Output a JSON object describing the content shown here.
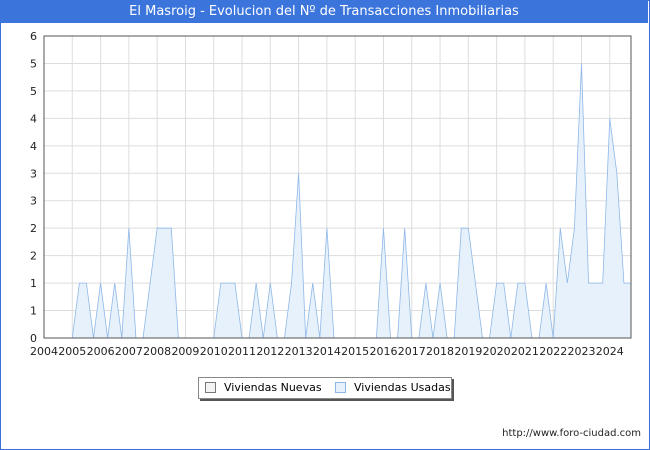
{
  "title": "El Masroig - Evolucion del Nº de Transacciones Inmobiliarias",
  "source_url": "http://www.foro-ciudad.com",
  "colors": {
    "title_bg": "#3b75dc",
    "nuevas": "#f4f4f4",
    "usadas_fill": "#e6f1fb",
    "usadas_line": "#8fb8e8",
    "grid": "#dddddd"
  },
  "chart_data": {
    "type": "area",
    "x_tick_labels": [
      "2004",
      "2005",
      "2006",
      "2007",
      "2008",
      "2009",
      "2010",
      "2011",
      "2012",
      "2013",
      "2014",
      "2015",
      "2016",
      "2017",
      "2018",
      "2019",
      "2020",
      "2021",
      "2022",
      "2023",
      "2024"
    ],
    "y_tick_labels": [
      "0",
      "1",
      "1",
      "2",
      "2",
      "3",
      "3",
      "4",
      "4",
      "5",
      "5",
      "6"
    ],
    "ylim": [
      0,
      5.5
    ],
    "xlim": [
      2004,
      2024.75
    ],
    "legend": {
      "position": "bottom-center",
      "entries": [
        "Viviendas Nuevas",
        "Viviendas Usadas"
      ]
    },
    "series": [
      {
        "name": "Viviendas Usadas",
        "x": [
          2005.0,
          2005.25,
          2005.5,
          2005.75,
          2006.0,
          2006.25,
          2006.5,
          2006.75,
          2007.0,
          2007.25,
          2007.5,
          2007.75,
          2008.0,
          2008.25,
          2008.5,
          2008.75,
          2009.0,
          2009.25,
          2009.5,
          2009.75,
          2010.0,
          2010.25,
          2010.5,
          2010.75,
          2011.0,
          2011.25,
          2011.5,
          2011.75,
          2012.0,
          2012.25,
          2012.5,
          2012.75,
          2013.0,
          2013.25,
          2013.5,
          2013.75,
          2014.0,
          2014.25,
          2014.5,
          2014.75,
          2015.0,
          2015.25,
          2015.5,
          2015.75,
          2016.0,
          2016.25,
          2016.5,
          2016.75,
          2017.0,
          2017.25,
          2017.5,
          2017.75,
          2018.0,
          2018.25,
          2018.5,
          2018.75,
          2019.0,
          2019.25,
          2019.5,
          2019.75,
          2020.0,
          2020.25,
          2020.5,
          2020.75,
          2021.0,
          2021.25,
          2021.5,
          2021.75,
          2022.0,
          2022.25,
          2022.5,
          2022.75,
          2023.0,
          2023.25,
          2023.5,
          2023.75,
          2024.0,
          2024.25,
          2024.5,
          2024.75
        ],
        "values": [
          0,
          1,
          1,
          0,
          1,
          0,
          1,
          0,
          2,
          0,
          0,
          1,
          2,
          2,
          2,
          0,
          0,
          0,
          0,
          0,
          0,
          1,
          1,
          1,
          0,
          0,
          1,
          0,
          1,
          0,
          0,
          1,
          3,
          0,
          1,
          0,
          2,
          0,
          0,
          0,
          0,
          0,
          0,
          0,
          2,
          0,
          0,
          2,
          0,
          0,
          1,
          0,
          1,
          0,
          0,
          2,
          2,
          1,
          0,
          0,
          1,
          1,
          0,
          1,
          1,
          0,
          0,
          1,
          0,
          2,
          1,
          2,
          5,
          1,
          1,
          1,
          4,
          3,
          1,
          1
        ]
      },
      {
        "name": "Viviendas Nuevas",
        "x": [
          2004.0,
          2024.75
        ],
        "values": [
          0,
          0
        ]
      }
    ]
  }
}
